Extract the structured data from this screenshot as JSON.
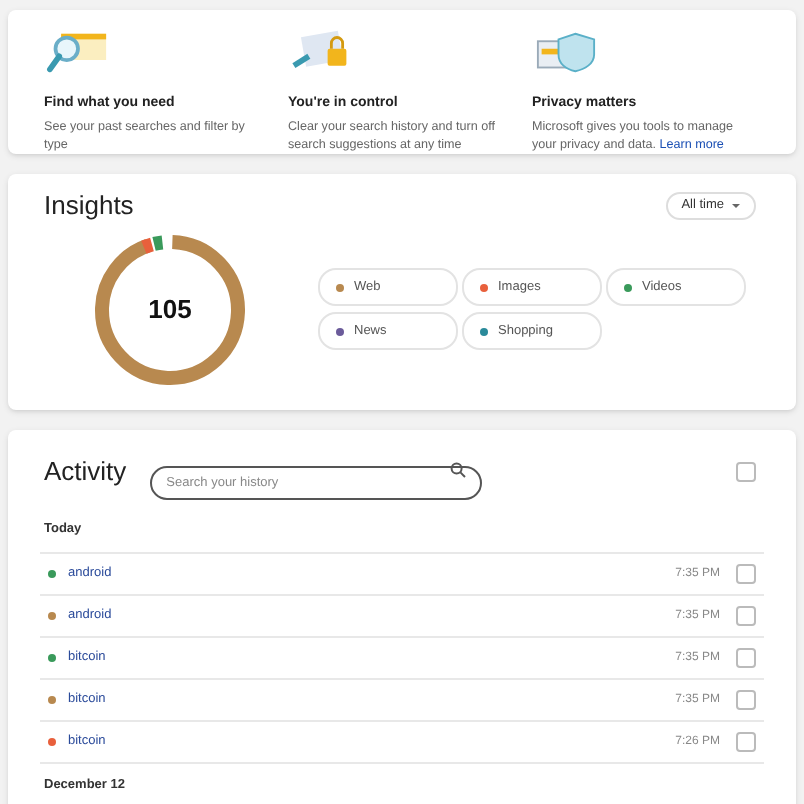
{
  "features": [
    {
      "kind": "search",
      "title": "Find what you need",
      "text": "See your past searches and filter by type"
    },
    {
      "kind": "lock",
      "title": "You're in control",
      "text": "Clear your search history and turn off search suggestions at any time"
    },
    {
      "kind": "shield",
      "title": "Privacy matters",
      "text": "Microsoft gives you tools to manage your privacy and data.",
      "link": "Learn more"
    }
  ],
  "insights": {
    "title": "Insights",
    "range": "All time",
    "total": "105",
    "legend": [
      {
        "label": "Web",
        "color": "#b8894f"
      },
      {
        "label": "Images",
        "color": "#e8603c"
      },
      {
        "label": "Videos",
        "color": "#3a9a5b"
      },
      {
        "label": "News",
        "color": "#6b5b9a"
      },
      {
        "label": "Shopping",
        "color": "#2a8a9a"
      }
    ]
  },
  "activity": {
    "title": "Activity",
    "search_placeholder": "Search your history",
    "select_all_checked": false,
    "groups": [
      {
        "label": "Today",
        "rows": [
          {
            "query": "android",
            "time": "7:35 PM",
            "color": "#3a9a5b",
            "checked": false
          },
          {
            "query": "android",
            "time": "7:35 PM",
            "color": "#b8894f",
            "checked": false
          },
          {
            "query": "bitcoin",
            "time": "7:35 PM",
            "color": "#3a9a5b",
            "checked": false
          },
          {
            "query": "bitcoin",
            "time": "7:35 PM",
            "color": "#b8894f",
            "checked": false
          },
          {
            "query": "bitcoin",
            "time": "7:26 PM",
            "color": "#e8603c",
            "checked": false
          }
        ]
      },
      {
        "label": "December 12"
      }
    ]
  }
}
